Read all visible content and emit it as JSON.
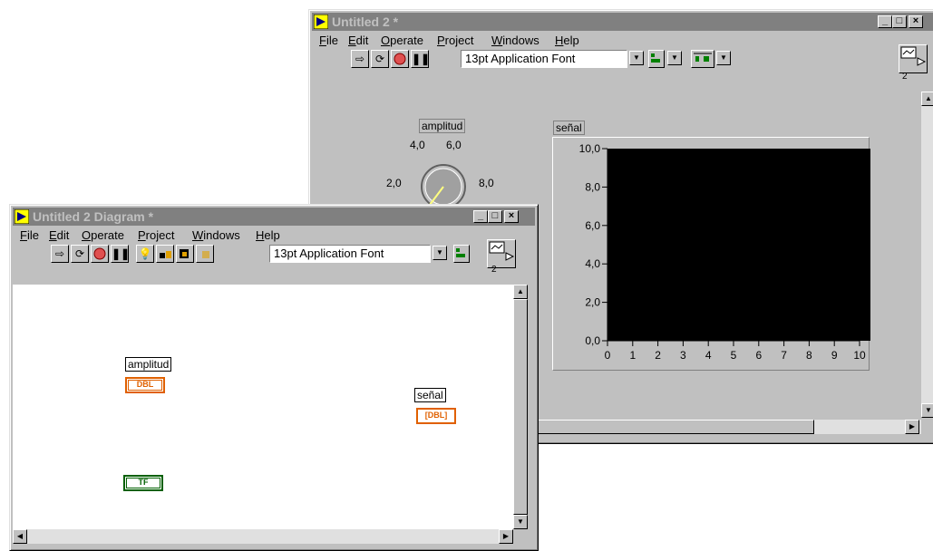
{
  "front_panel": {
    "title": "Untitled 2 *",
    "menu": [
      "File",
      "Edit",
      "Operate",
      "Project",
      "Windows",
      "Help"
    ],
    "menu_underline": [
      "F",
      "E",
      "O",
      "P",
      "W",
      "H"
    ],
    "font_selector": "13pt Application Font",
    "connector_number": "2",
    "knob": {
      "label": "amplitud",
      "ticks": [
        "4,0",
        "6,0",
        "2,0",
        "8,0"
      ],
      "value": 4
    },
    "graph": {
      "label": "señal",
      "y_ticks": [
        "10,0",
        "8,0",
        "6,0",
        "4,0",
        "2,0",
        "0,0"
      ],
      "x_ticks": [
        "0",
        "1",
        "2",
        "3",
        "4",
        "5",
        "6",
        "7",
        "8",
        "9",
        "10"
      ]
    }
  },
  "diagram": {
    "title": "Untitled 2 Diagram *",
    "menu": [
      "File",
      "Edit",
      "Operate",
      "Project",
      "Windows",
      "Help"
    ],
    "font_selector": "13pt Application Font",
    "connector_number": "2",
    "terminals": [
      {
        "label": "amplitud",
        "type": "DBL",
        "color": "#e06000"
      },
      {
        "label": "señal",
        "type": "[DBL]",
        "color": "#e06000"
      },
      {
        "label": "",
        "type": "TF",
        "color": "#006000"
      }
    ]
  },
  "colors": {
    "title_inactive": "#808080",
    "plot_bg": "#000000",
    "window_bg": "#c0c0c0"
  },
  "icons": [
    "run-arrow-icon",
    "run-continuous-icon",
    "abort-icon",
    "pause-icon",
    "highlight-execution-icon",
    "step-into-icon",
    "step-over-icon",
    "step-out-icon",
    "vi-icon",
    "minimize-icon",
    "maximize-icon",
    "close-icon"
  ]
}
